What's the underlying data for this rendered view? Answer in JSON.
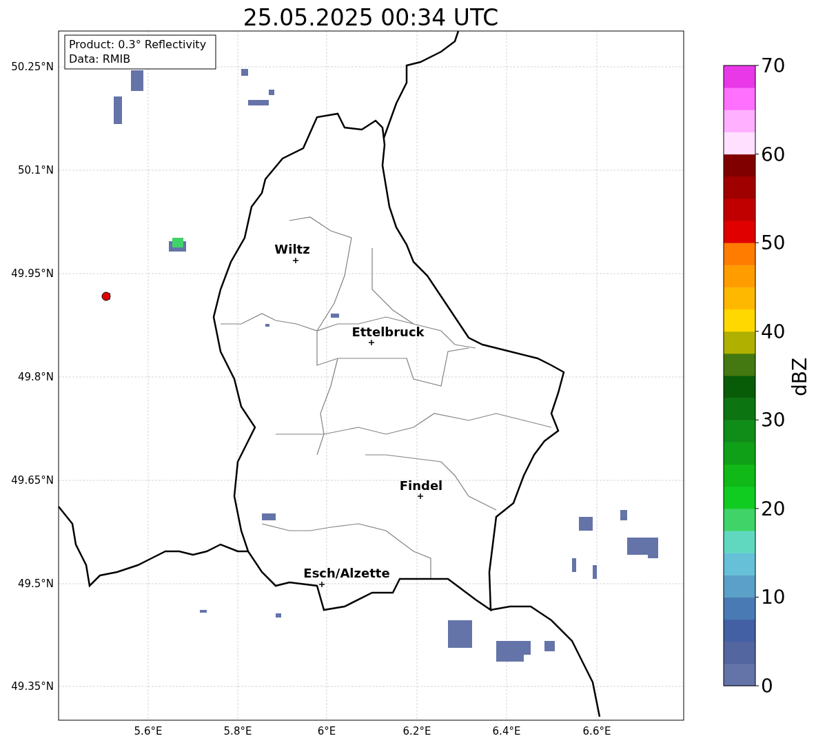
{
  "title": "25.05.2025 00:34 UTC",
  "info_box": {
    "lines": [
      "Product: 0.3° Reflectivity",
      "Data: RMIB"
    ]
  },
  "cities": [
    {
      "name": "Wiltz"
    },
    {
      "name": "Ettelbruck"
    },
    {
      "name": "Findel"
    },
    {
      "name": "Esch/Alzette"
    }
  ],
  "lat_ticks": [
    "50.25°N",
    "50.1°N",
    "49.95°N",
    "49.8°N",
    "49.65°N",
    "49.5°N",
    "49.35°N"
  ],
  "lon_ticks": [
    "5.6°E",
    "5.8°E",
    "6°E",
    "6.2°E",
    "6.4°E",
    "6.6°E"
  ],
  "colorbar": {
    "label": "dBZ",
    "ticks": [
      "70",
      "60",
      "50",
      "40",
      "30",
      "20",
      "10",
      "0"
    ],
    "bands": [
      {
        "color": "#6474a8"
      },
      {
        "color": "#5466a0"
      },
      {
        "color": "#4460a4"
      },
      {
        "color": "#4a7ab4"
      },
      {
        "color": "#5aa0c8"
      },
      {
        "color": "#66c0d8"
      },
      {
        "color": "#60d8c0"
      },
      {
        "color": "#40d468"
      },
      {
        "color": "#10cc20"
      },
      {
        "color": "#10b818"
      },
      {
        "color": "#10a018"
      },
      {
        "color": "#108c18"
      },
      {
        "color": "#0c7410"
      },
      {
        "color": "#085c08"
      },
      {
        "color": "#447810"
      },
      {
        "color": "#b0b000"
      },
      {
        "color": "#ffd800"
      },
      {
        "color": "#ffb800"
      },
      {
        "color": "#ff9c00"
      },
      {
        "color": "#ff7c00"
      },
      {
        "color": "#e00000"
      },
      {
        "color": "#c00000"
      },
      {
        "color": "#a00000"
      },
      {
        "color": "#800000"
      },
      {
        "color": "#ffe0ff"
      },
      {
        "color": "#ffb0ff"
      },
      {
        "color": "#ff70ff"
      },
      {
        "color": "#e838e8"
      }
    ]
  }
}
